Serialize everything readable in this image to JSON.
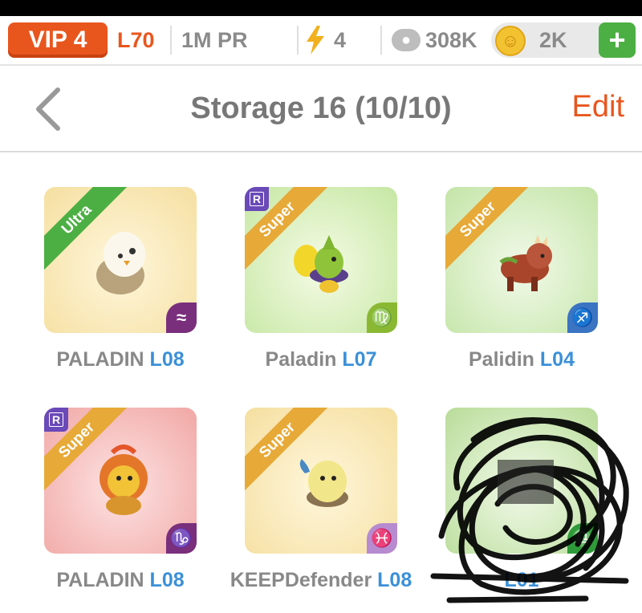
{
  "status": {
    "vip": "VIP 4",
    "level": "L70",
    "pr": "1M PR",
    "energy": "4",
    "paws": "308K",
    "coins": "2K",
    "add": "+"
  },
  "nav": {
    "title": "Storage 16 (10/10)",
    "edit": "Edit"
  },
  "cards": [
    {
      "rarity": "Ultra",
      "name": "PALADIN ",
      "level": "L08",
      "zodiac": "≈",
      "badge": ""
    },
    {
      "rarity": "Super",
      "name": "Paladin ",
      "level": "L07",
      "zodiac": "♍",
      "badge": "R"
    },
    {
      "rarity": "Super",
      "name": "Palidin ",
      "level": "L04",
      "zodiac": "♐",
      "badge": ""
    },
    {
      "rarity": "Super",
      "name": "PALADIN ",
      "level": "L08",
      "zodiac": "♑",
      "badge": "R"
    },
    {
      "rarity": "Super",
      "name": "KEEPDefender ",
      "level": "L08",
      "zodiac": "♓",
      "badge": ""
    },
    {
      "rarity": "",
      "name": "",
      "level": "L01",
      "zodiac": "♎",
      "badge": ""
    }
  ],
  "colors": {
    "accent": "#e8561e",
    "level_blue": "#3b90d8",
    "ribbon_ultra": "#4caf43",
    "ribbon_super": "#e7a937",
    "badge_purple": "#6a49b8"
  }
}
